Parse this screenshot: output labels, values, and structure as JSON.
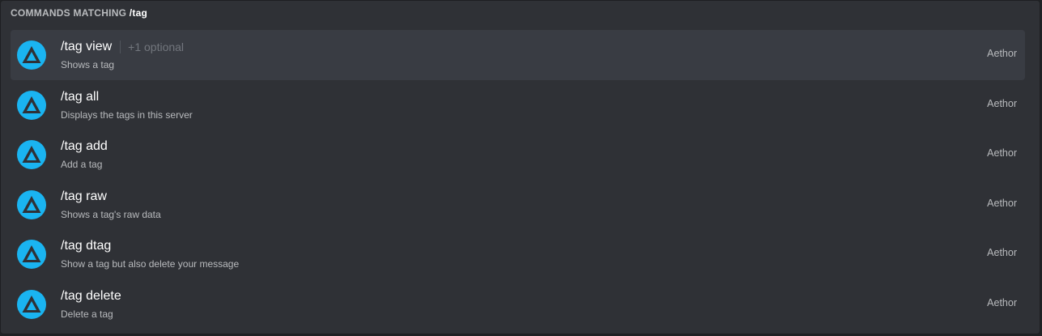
{
  "header": {
    "prefix": "COMMANDS MATCHING",
    "query": "/tag"
  },
  "commands": [
    {
      "name": "/tag view",
      "optional": "+1 optional",
      "description": "Shows a tag",
      "source": "Aethor",
      "selected": true
    },
    {
      "name": "/tag all",
      "optional": "",
      "description": "Displays the tags in this server",
      "source": "Aethor",
      "selected": false
    },
    {
      "name": "/tag add",
      "optional": "",
      "description": "Add a tag",
      "source": "Aethor",
      "selected": false
    },
    {
      "name": "/tag raw",
      "optional": "",
      "description": "Shows a tag's raw data",
      "source": "Aethor",
      "selected": false
    },
    {
      "name": "/tag dtag",
      "optional": "",
      "description": "Show a tag but also delete your message",
      "source": "Aethor",
      "selected": false
    },
    {
      "name": "/tag delete",
      "optional": "",
      "description": "Delete a tag",
      "source": "Aethor",
      "selected": false
    }
  ],
  "colors": {
    "background": "#2f3136",
    "selected_row": "#393c43",
    "avatar": "#1ab4f1",
    "avatar_mark": "#2f3136",
    "text_primary": "#ffffff",
    "text_secondary": "#b9bbbe",
    "text_muted": "#72767d"
  },
  "icons": {
    "avatar": "aethor-triangle-logo"
  }
}
